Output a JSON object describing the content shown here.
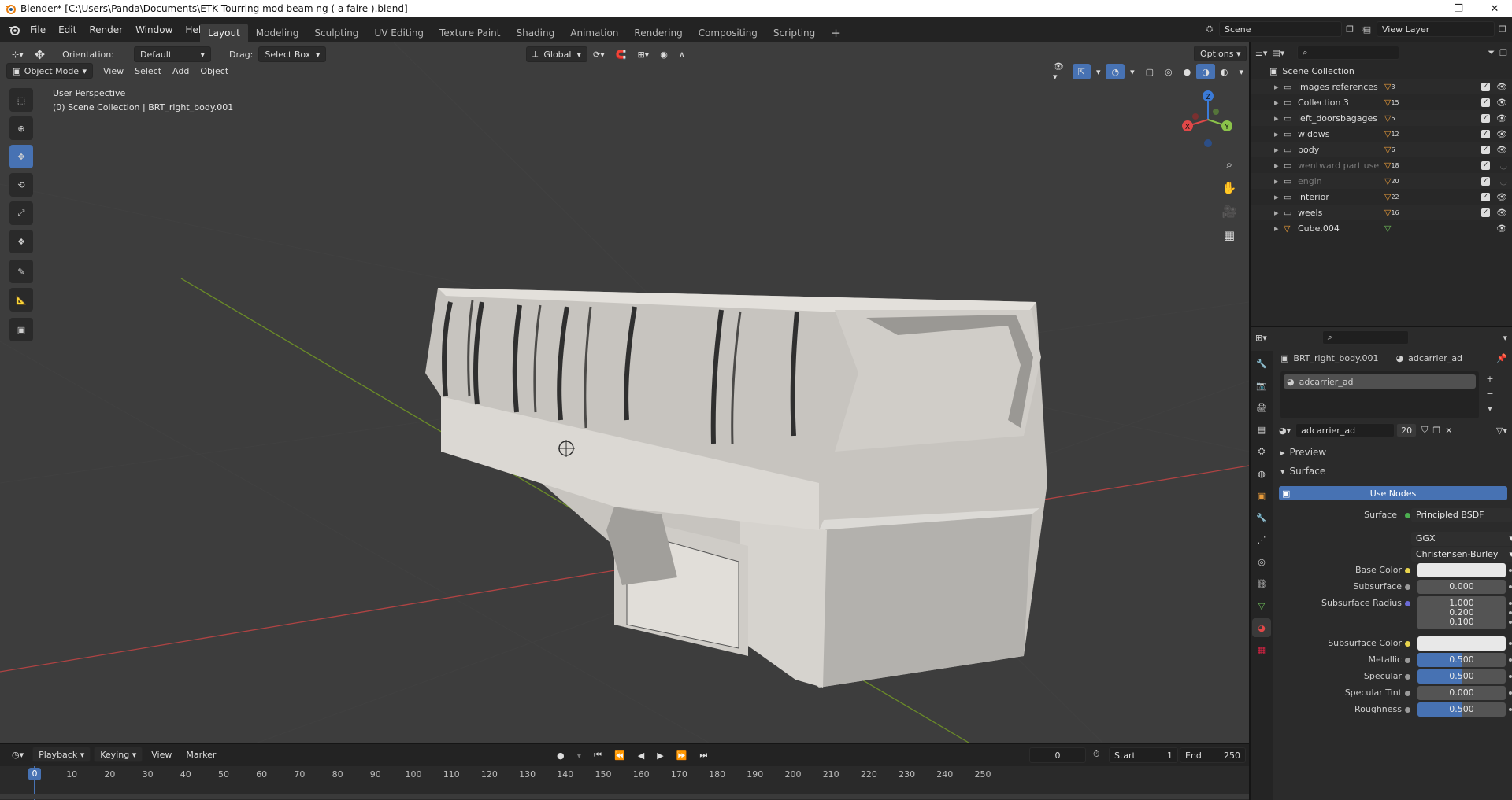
{
  "window": {
    "title": "Blender* [C:\\Users\\Panda\\Documents\\ETK Tourring mod beam ng ( a faire ).blend]",
    "minimize": "—",
    "maximize": "❐",
    "close": "✕"
  },
  "menu": [
    "File",
    "Edit",
    "Render",
    "Window",
    "Help"
  ],
  "workspaces": [
    "Layout",
    "Modeling",
    "Sculpting",
    "UV Editing",
    "Texture Paint",
    "Shading",
    "Animation",
    "Rendering",
    "Compositing",
    "Scripting"
  ],
  "add_workspace": "+",
  "scene": {
    "name": "Scene",
    "view_layer": "View Layer"
  },
  "tool_header": {
    "orientation_label": "Orientation:",
    "orientation_value": "Default",
    "drag_label": "Drag:",
    "drag_value": "Select Box",
    "transform_orientation": "Global",
    "options": "Options"
  },
  "viewport_header": {
    "mode": "Object Mode",
    "menus": [
      "View",
      "Select",
      "Add",
      "Object"
    ]
  },
  "viewport": {
    "perspective": "User Perspective",
    "collection_info": "(0) Scene Collection | BRT_right_body.001",
    "gizmo_axes": {
      "z": "Z",
      "y": "Y",
      "x": "X"
    }
  },
  "outliner": {
    "root": "Scene Collection",
    "items": [
      {
        "name": "images references",
        "badge": "3",
        "dim": false
      },
      {
        "name": "Collection 3",
        "badge": "15",
        "dim": false
      },
      {
        "name": "left_doorsbagages",
        "badge": "5",
        "dim": false
      },
      {
        "name": "widows",
        "badge": "12",
        "dim": false
      },
      {
        "name": "body",
        "badge": "6",
        "dim": false
      },
      {
        "name": "wentward part use",
        "badge": "18",
        "dim": true
      },
      {
        "name": "engin",
        "badge": "20",
        "dim": true
      },
      {
        "name": "interior",
        "badge": "22",
        "dim": false
      },
      {
        "name": "weels",
        "badge": "16",
        "dim": false
      },
      {
        "name": "Cube.004",
        "badge": "",
        "dim": false
      }
    ]
  },
  "properties": {
    "object_name": "BRT_right_body.001",
    "material_name": "adcarrier_ad",
    "slot_name": "adcarrier_ad",
    "material_field": "adcarrier_ad",
    "user_count": "20",
    "panels": {
      "preview": "Preview",
      "surface": "Surface"
    },
    "use_nodes": "Use Nodes",
    "surface_label": "Surface",
    "surface_value": "Principled BSDF",
    "distribution": "GGX",
    "subsurface_method": "Christensen-Burley",
    "fields": [
      {
        "label": "Base Color",
        "value": "",
        "type": "color",
        "fill": 0
      },
      {
        "label": "Subsurface",
        "value": "0.000",
        "type": "num",
        "fill": 0
      },
      {
        "label": "Subsurface Radius",
        "value": "1.000",
        "type": "num",
        "fill": 0
      },
      {
        "label": "",
        "value": "0.200",
        "type": "num",
        "fill": 0
      },
      {
        "label": "",
        "value": "0.100",
        "type": "num",
        "fill": 0
      },
      {
        "label": "Subsurface Color",
        "value": "",
        "type": "color",
        "fill": 0
      },
      {
        "label": "Metallic",
        "value": "0.500",
        "type": "num",
        "fill": 0.5
      },
      {
        "label": "Specular",
        "value": "0.500",
        "type": "num",
        "fill": 0.5
      },
      {
        "label": "Specular Tint",
        "value": "0.000",
        "type": "num",
        "fill": 0
      },
      {
        "label": "Roughness",
        "value": "0.500",
        "type": "num",
        "fill": 0.5
      }
    ]
  },
  "timeline": {
    "menus": [
      "Playback",
      "Keying",
      "View",
      "Marker"
    ],
    "current_frame": "0",
    "start_label": "Start",
    "start": "1",
    "end_label": "End",
    "end": "250",
    "ticks": [
      "0",
      "10",
      "20",
      "30",
      "40",
      "50",
      "60",
      "70",
      "80",
      "90",
      "100",
      "110",
      "120",
      "130",
      "140",
      "150",
      "160",
      "170",
      "180",
      "190",
      "200",
      "210",
      "220",
      "230",
      "240",
      "250"
    ]
  },
  "colors": {
    "accent": "#4772b3",
    "viewport_bg": "#3d3d3d",
    "panel_bg": "#2b2b2b"
  }
}
